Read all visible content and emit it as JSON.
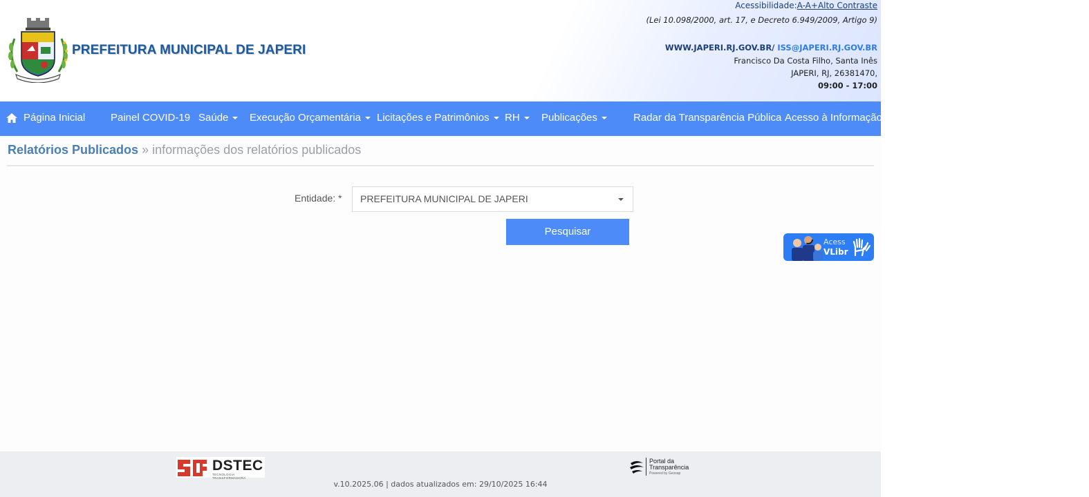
{
  "header": {
    "title": "PREFEITURA MUNICIPAL DE JAPERI",
    "accessibility_label": "Acessibilidade:",
    "acc_links": [
      "A-",
      "A+",
      "Alto Contraste"
    ],
    "law_note": "(Lei 10.098/2000, art. 17, e Decreto 6.949/2009, Artigo 9)",
    "website": "WWW.JAPERI.RJ.GOV.BR/",
    "email": "ISS@JAPERI.RJ.GOV.BR",
    "address_line1": "Francisco Da Costa Filho, Santa Inês",
    "address_line2": "JAPERI, RJ, 26381470,",
    "hours": "09:00 - 17:00"
  },
  "nav": {
    "items": [
      {
        "label": "Página Inicial"
      },
      {
        "label": "Painel COVID-19"
      },
      {
        "label": "Saúde"
      },
      {
        "label": "Execução Orçamentária"
      },
      {
        "label": "Licitações e Patrimônios"
      },
      {
        "label": "RH"
      },
      {
        "label": "Publicações"
      },
      {
        "label": "Radar da Transparência Pública"
      },
      {
        "label": "Acesso à Informação"
      }
    ]
  },
  "breadcrumb": {
    "main": "Relatórios Publicados",
    "separator": "»",
    "sub": "informações dos relatórios publicados"
  },
  "form": {
    "entity_label": "Entidade: *",
    "entity_value": "PREFEITURA MUNICIPAL DE JAPERI",
    "search_label": "Pesquisar"
  },
  "vlibras": {
    "line1": "Acess",
    "line2": "VLibr"
  },
  "footer": {
    "dstec_word": "DSTEC",
    "dstec_tagline": "TECNOLOGIA TRANSFORMADORA",
    "portal_line1": "Portal da",
    "portal_line2": "Transparência",
    "portal_line3": "Powered by Geosap",
    "version": "v.10.2025.06 | dados atualizados em: 29/10/2025 16:44"
  },
  "colors": {
    "nav_bg": "#4d8cf8",
    "title": "#1d5a9c",
    "breadcrumb": "#4a7fb5",
    "footer_bg": "#eceef1"
  }
}
